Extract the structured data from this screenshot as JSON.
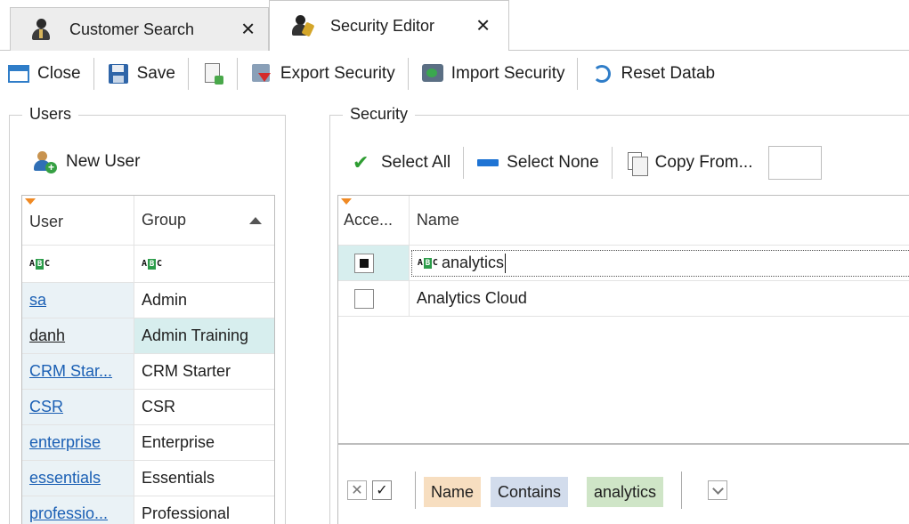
{
  "tabs": [
    {
      "label": "Customer Search",
      "icon": "user-icon",
      "close": "✕"
    },
    {
      "label": "Security Editor",
      "icon": "security-user-icon",
      "close": "✕"
    }
  ],
  "toolbar": {
    "close_label": "Close",
    "save_label": "Save",
    "export_label": "Export Security",
    "import_label": "Import Security",
    "reset_label": "Reset Datab"
  },
  "users": {
    "group_title": "Users",
    "new_user_label": "New User",
    "columns": [
      "User",
      "Group"
    ],
    "filter_row": [
      "ABC",
      "ABC"
    ],
    "rows": [
      {
        "user": "sa",
        "group": "Admin"
      },
      {
        "user": "danh",
        "group": "Admin Training"
      },
      {
        "user": "CRM Star...",
        "group": "CRM Starter"
      },
      {
        "user": "CSR",
        "group": "CSR"
      },
      {
        "user": "enterprise",
        "group": "Enterprise"
      },
      {
        "user": "essentials",
        "group": "Essentials"
      },
      {
        "user": "professio...",
        "group": "Professional"
      }
    ]
  },
  "security": {
    "group_title": "Security",
    "select_all_label": "Select All",
    "select_none_label": "Select None",
    "copy_from_label": "Copy From...",
    "columns": [
      "Acce...",
      "Name"
    ],
    "filter_value": "analytics",
    "rows": [
      {
        "name": "Analytics Cloud",
        "access": false
      }
    ],
    "filter_panel": {
      "clear": "✕",
      "enabled": "✓",
      "field": "Name",
      "operator": "Contains",
      "value": "analytics"
    }
  },
  "colors": {
    "accent": "#2f7dc8",
    "link": "#1a5fb4",
    "selected_row": "#d7eeee",
    "token_field": "#f7dec0",
    "token_operator": "#d2dcec",
    "token_value": "#cfe5c7"
  }
}
